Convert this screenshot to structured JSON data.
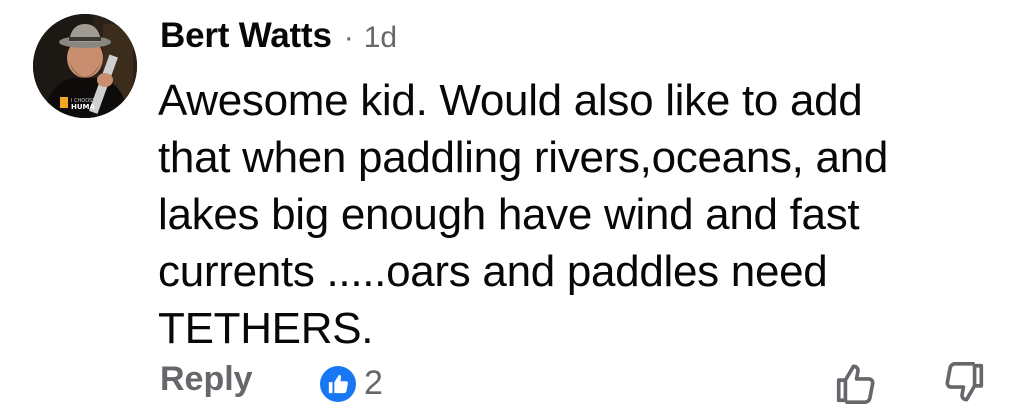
{
  "comment": {
    "author": "Bert Watts",
    "separator": "·",
    "timestamp": "1d",
    "text": "Awesome kid. Would also like to add\nthat when paddling rivers,oceans, and\nlakes big enough have wind and fast\ncurrents .....oars and paddles need\nTETHERS.",
    "avatar": {
      "badge_line1": "I CHOOSE",
      "badge_line2": "HUMA"
    }
  },
  "actions": {
    "reply_label": "Reply",
    "reaction_count": "2",
    "reaction_icon": "like-icon",
    "upvote_icon": "thumbs-up-outline-icon",
    "downvote_icon": "thumbs-down-outline-icon"
  },
  "colors": {
    "text_primary": "#080809",
    "text_secondary": "#65676b",
    "like_blue": "#1877f2",
    "background": "#ffffff"
  }
}
